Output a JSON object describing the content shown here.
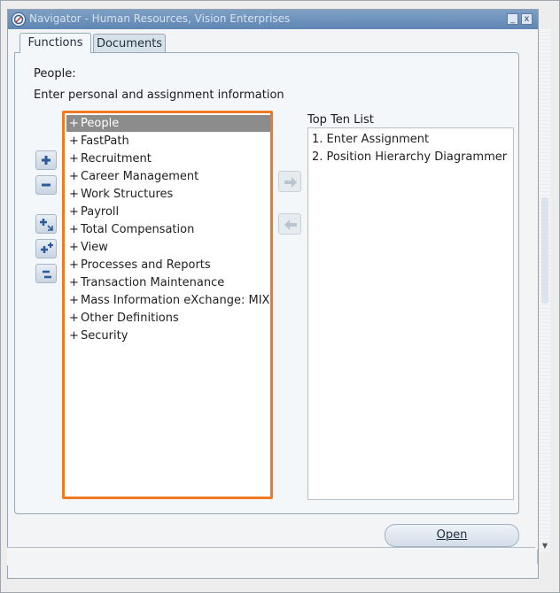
{
  "window": {
    "title": "Navigator - Human Resources, Vision Enterprises",
    "minimize_label": "_",
    "close_label": "x"
  },
  "tabs": [
    {
      "label": "Functions",
      "selected": true
    },
    {
      "label": "Documents",
      "selected": false
    }
  ],
  "panel": {
    "heading": "People:",
    "description": "Enter personal and assignment information"
  },
  "tree": {
    "items": [
      {
        "expander": "+",
        "label": "People",
        "selected": true
      },
      {
        "expander": "+",
        "label": "FastPath"
      },
      {
        "expander": "+",
        "label": "Recruitment"
      },
      {
        "expander": "+",
        "label": "Career Management"
      },
      {
        "expander": "+",
        "label": "Work Structures"
      },
      {
        "expander": "+",
        "label": "Payroll"
      },
      {
        "expander": "+",
        "label": "Total Compensation"
      },
      {
        "expander": "+",
        "label": "View"
      },
      {
        "expander": "+",
        "label": "Processes and Reports"
      },
      {
        "expander": "+",
        "label": "Transaction Maintenance"
      },
      {
        "expander": "+",
        "label": "Mass Information eXchange: MIX"
      },
      {
        "expander": "+",
        "label": "Other Definitions"
      },
      {
        "expander": "+",
        "label": "Security"
      }
    ]
  },
  "top_ten": {
    "label": "Top Ten List",
    "items": [
      "1. Enter Assignment",
      "2. Position Hierarchy Diagrammer"
    ]
  },
  "buttons": {
    "open_label": "Open"
  },
  "colors": {
    "highlight_border": "#f07a23",
    "selected_row": "#8c8c8c",
    "titlebar": "#6d93bd"
  }
}
